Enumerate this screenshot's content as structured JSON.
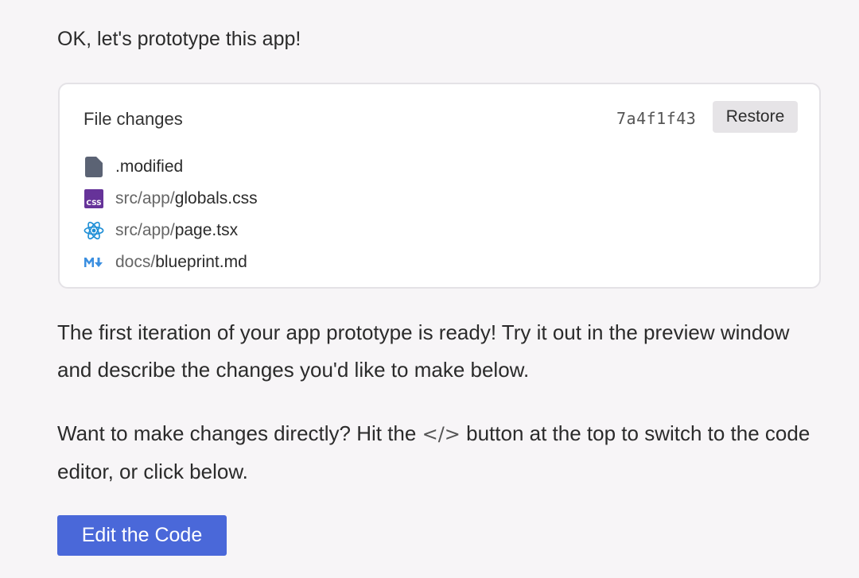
{
  "message": {
    "intro": "OK, let's prototype this app!",
    "paragraph1": "The first iteration of your app prototype is ready! Try it out in the preview window and describe the changes you'd like to make below.",
    "paragraph2_before": "Want to make changes directly? Hit the ",
    "paragraph2_icon": "</>",
    "paragraph2_after": " button at the top to switch to the code editor, or click below.",
    "edit_button": "Edit the Code"
  },
  "file_changes": {
    "title": "File changes",
    "commit_hash": "7a4f1f43",
    "restore_label": "Restore",
    "files": [
      {
        "icon": "file-icon",
        "dir": "",
        "name": ".modified",
        "color": "#5b6374"
      },
      {
        "icon": "css-icon",
        "dir": "src/app/",
        "name": "globals.css",
        "color": "#663399"
      },
      {
        "icon": "react-icon",
        "dir": "src/app/",
        "name": "page.tsx",
        "color": "#1f8fd6"
      },
      {
        "icon": "markdown-icon",
        "dir": "docs/",
        "name": "blueprint.md",
        "color": "#3b8fe0"
      }
    ]
  },
  "colors": {
    "accent": "#4a68d9",
    "background": "#f7f5f7"
  }
}
